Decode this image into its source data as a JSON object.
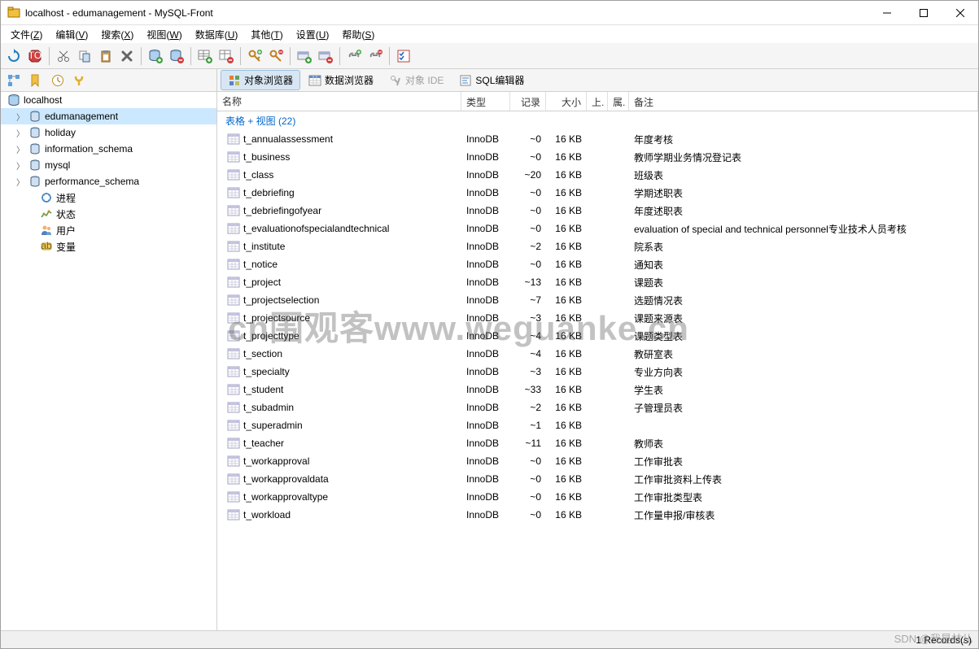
{
  "window": {
    "title": "localhost - edumanagement - MySQL-Front"
  },
  "menus": [
    {
      "label": "文件",
      "key": "Z"
    },
    {
      "label": "编辑",
      "key": "V"
    },
    {
      "label": "搜索",
      "key": "X"
    },
    {
      "label": "视图",
      "key": "W"
    },
    {
      "label": "数据库",
      "key": "U"
    },
    {
      "label": "其他",
      "key": "T"
    },
    {
      "label": "设置",
      "key": "U"
    },
    {
      "label": "帮助",
      "key": "S"
    }
  ],
  "subtabs": [
    {
      "label": "对象浏览器",
      "active": true,
      "icon": "object"
    },
    {
      "label": "数据浏览器",
      "active": false,
      "icon": "data"
    },
    {
      "label": "对象 IDE",
      "active": false,
      "icon": "ide",
      "disabled": true
    },
    {
      "label": "SQL编辑器",
      "active": false,
      "icon": "sql"
    }
  ],
  "tree": {
    "root": {
      "label": "localhost",
      "icon": "host"
    },
    "items": [
      {
        "label": "edumanagement",
        "icon": "db",
        "exp": true,
        "selected": true,
        "indent": 1
      },
      {
        "label": "holiday",
        "icon": "db",
        "exp": true,
        "indent": 1
      },
      {
        "label": "information_schema",
        "icon": "db",
        "exp": true,
        "indent": 1
      },
      {
        "label": "mysql",
        "icon": "db",
        "exp": true,
        "indent": 1
      },
      {
        "label": "performance_schema",
        "icon": "db",
        "exp": true,
        "indent": 1
      },
      {
        "label": "进程",
        "icon": "process",
        "indent": 2
      },
      {
        "label": "状态",
        "icon": "status",
        "indent": 2
      },
      {
        "label": "用户",
        "icon": "users",
        "indent": 2
      },
      {
        "label": "变量",
        "icon": "vars",
        "indent": 2
      }
    ]
  },
  "columns": {
    "name": "名称",
    "type": "类型",
    "records": "记录",
    "size": "大小",
    "up": "上.",
    "attr": "属.",
    "note": "备注"
  },
  "summary": "表格 + 视图 (22)",
  "tables": [
    {
      "name": "t_annualassessment",
      "type": "InnoDB",
      "rec": "~0",
      "size": "16 KB",
      "note": "年度考核"
    },
    {
      "name": "t_business",
      "type": "InnoDB",
      "rec": "~0",
      "size": "16 KB",
      "note": "教师学期业务情况登记表"
    },
    {
      "name": "t_class",
      "type": "InnoDB",
      "rec": "~20",
      "size": "16 KB",
      "note": "班级表"
    },
    {
      "name": "t_debriefing",
      "type": "InnoDB",
      "rec": "~0",
      "size": "16 KB",
      "note": "学期述职表"
    },
    {
      "name": "t_debriefingofyear",
      "type": "InnoDB",
      "rec": "~0",
      "size": "16 KB",
      "note": "年度述职表"
    },
    {
      "name": "t_evaluationofspecialandtechnical",
      "type": "InnoDB",
      "rec": "~0",
      "size": "16 KB",
      "note": "evaluation of special and technical personnel专业技术人员考核"
    },
    {
      "name": "t_institute",
      "type": "InnoDB",
      "rec": "~2",
      "size": "16 KB",
      "note": "院系表"
    },
    {
      "name": "t_notice",
      "type": "InnoDB",
      "rec": "~0",
      "size": "16 KB",
      "note": "通知表"
    },
    {
      "name": "t_project",
      "type": "InnoDB",
      "rec": "~13",
      "size": "16 KB",
      "note": "课题表"
    },
    {
      "name": "t_projectselection",
      "type": "InnoDB",
      "rec": "~7",
      "size": "16 KB",
      "note": "选题情况表"
    },
    {
      "name": "t_projectsource",
      "type": "InnoDB",
      "rec": "~3",
      "size": "16 KB",
      "note": "课题来源表"
    },
    {
      "name": "t_projecttype",
      "type": "InnoDB",
      "rec": "~4",
      "size": "16 KB",
      "note": "课题类型表"
    },
    {
      "name": "t_section",
      "type": "InnoDB",
      "rec": "~4",
      "size": "16 KB",
      "note": "教研室表"
    },
    {
      "name": "t_specialty",
      "type": "InnoDB",
      "rec": "~3",
      "size": "16 KB",
      "note": "专业方向表"
    },
    {
      "name": "t_student",
      "type": "InnoDB",
      "rec": "~33",
      "size": "16 KB",
      "note": "学生表"
    },
    {
      "name": "t_subadmin",
      "type": "InnoDB",
      "rec": "~2",
      "size": "16 KB",
      "note": "子管理员表"
    },
    {
      "name": "t_superadmin",
      "type": "InnoDB",
      "rec": "~1",
      "size": "16 KB",
      "note": ""
    },
    {
      "name": "t_teacher",
      "type": "InnoDB",
      "rec": "~11",
      "size": "16 KB",
      "note": "教师表"
    },
    {
      "name": "t_workapproval",
      "type": "InnoDB",
      "rec": "~0",
      "size": "16 KB",
      "note": "工作审批表"
    },
    {
      "name": "t_workapprovaldata",
      "type": "InnoDB",
      "rec": "~0",
      "size": "16 KB",
      "note": "工作审批资料上传表"
    },
    {
      "name": "t_workapprovaltype",
      "type": "InnoDB",
      "rec": "~0",
      "size": "16 KB",
      "note": "工作审批类型表"
    },
    {
      "name": "t_workload",
      "type": "InnoDB",
      "rec": "~0",
      "size": "16 KB",
      "note": "工作量申报/审核表"
    }
  ],
  "status": "1 Records(s)",
  "watermark": "cn围观客www.weguanke.cn",
  "wm2": "SDN @我是林儿"
}
